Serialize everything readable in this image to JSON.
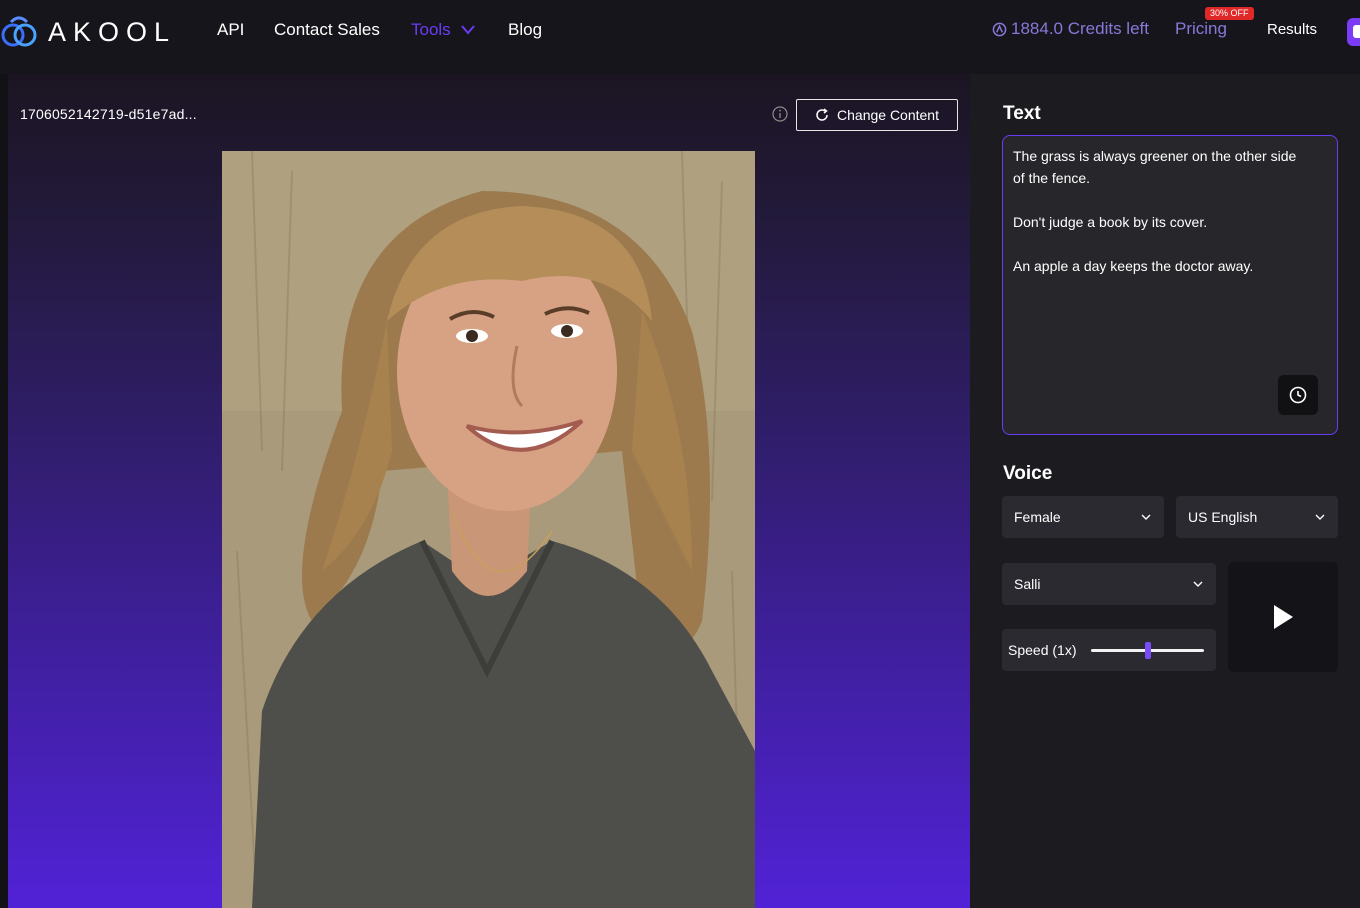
{
  "brand": {
    "logo_text": "AKOOL"
  },
  "nav": {
    "items": [
      {
        "label": "API"
      },
      {
        "label": "Contact Sales"
      },
      {
        "label": "Tools"
      },
      {
        "label": "Blog"
      }
    ],
    "credits_label": "1884.0 Credits left",
    "pricing_label": "Pricing",
    "discount_badge": "30% OFF",
    "results_label": "Results"
  },
  "stage": {
    "filename": "1706052142719-d51e7ad...",
    "change_content_label": "Change Content"
  },
  "text_section": {
    "title": "Text",
    "lines": [
      "The grass is always greener on the other side",
      "of the fence.",
      "Don't judge a book by its cover.",
      "An apple a day keeps the doctor away."
    ]
  },
  "voice_section": {
    "title": "Voice",
    "gender": "Female",
    "language": "US English",
    "voice_name": "Salli",
    "speed_label": "Speed (1x)",
    "speed_fraction": 0.5
  },
  "colors": {
    "accent": "#6b3cf5",
    "credits": "#8a78d9",
    "badge": "#e02828",
    "panel_bg": "#1c1b20"
  },
  "icons": {
    "logo": "akool-logo-icon",
    "tools_chevron": "chevron-down-icon",
    "credits": "credits-coin-icon",
    "info": "info-icon",
    "refresh": "refresh-icon",
    "history": "clock-icon",
    "play": "play-icon"
  }
}
